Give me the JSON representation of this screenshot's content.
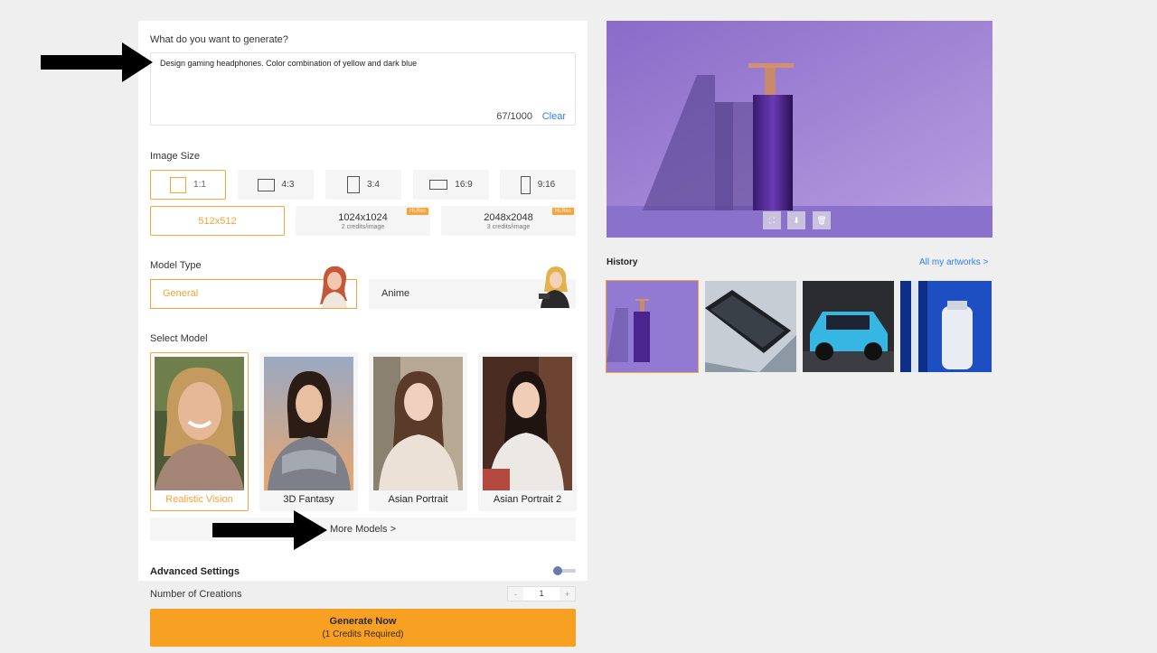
{
  "prompt": {
    "label": "What do you want to generate?",
    "value": "Design gaming headphones. Color combination of yellow and dark blue",
    "counter": "67/1000",
    "clear": "Clear"
  },
  "image_size": {
    "label": "Image Size",
    "ratios": [
      "1:1",
      "4:3",
      "3:4",
      "16:9",
      "9:16"
    ],
    "resolutions": [
      {
        "size": "512x512",
        "note": ""
      },
      {
        "size": "1024x1024",
        "note": "2 credits/image",
        "badge": "Hi.Res"
      },
      {
        "size": "2048x2048",
        "note": "3 credits/image",
        "badge": "Hi.Res"
      }
    ]
  },
  "model_type": {
    "label": "Model Type",
    "options": [
      "General",
      "Anime"
    ]
  },
  "select_model": {
    "label": "Select Model",
    "models": [
      "Realistic Vision",
      "3D Fantasy",
      "Asian Portrait",
      "Asian Portrait 2"
    ],
    "more": "More Models >"
  },
  "advanced": {
    "label": "Advanced Settings",
    "creations_label": "Number of Creations",
    "creations_value": "1",
    "minus": "-",
    "plus": "+"
  },
  "generate": {
    "label": "Generate Now",
    "sub": "(1 Credits Required)"
  },
  "history": {
    "title": "History",
    "all_link": "All my artworks >"
  },
  "colors": {
    "accent": "#f7a23b",
    "button": "#f7a022",
    "link": "#2f80ed",
    "preview_bg": "#9a7fd6"
  }
}
